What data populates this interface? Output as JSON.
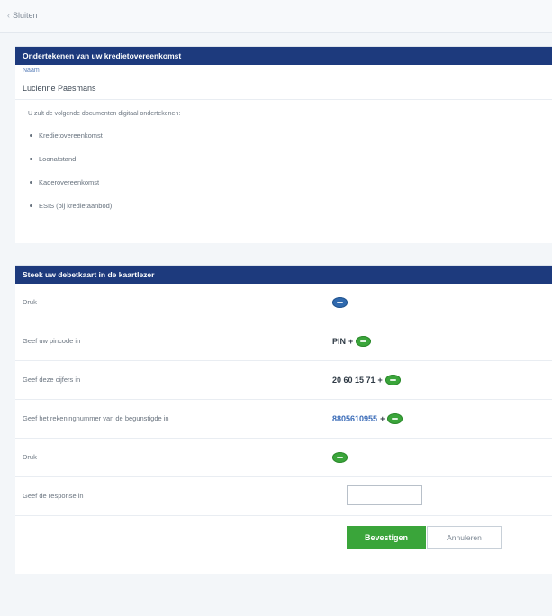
{
  "nav": {
    "back_label": "Sluiten"
  },
  "sign_panel": {
    "title": "Ondertekenen van uw kredietovereenkomst",
    "name_label": "Naam",
    "name_value": "Lucienne Paesmans",
    "intro": "U zult de volgende documenten digitaal ondertekenen:",
    "documents": [
      "Kredietovereenkomst",
      "Loonafstand",
      "Kaderovereenkomst",
      "ESIS (bij kredietaanbod)"
    ]
  },
  "card_panel": {
    "title": "Steek uw debetkaart in de kaartlezer",
    "steps": [
      {
        "label": "Druk",
        "value": "",
        "key": "blue-icon"
      },
      {
        "label": "Geef uw pincode in",
        "value": "PIN",
        "key": "ok-icon"
      },
      {
        "label": "Geef deze cijfers in",
        "value": "20 60 15 71",
        "key": "ok-icon"
      },
      {
        "label": "Geef het rekeningnummer van de begunstigde in",
        "value": "8805610955",
        "key": "ok-icon"
      },
      {
        "label": "Druk",
        "value": "",
        "key": "ok-icon"
      }
    ],
    "response_label": "Geef de response in",
    "response_value": "",
    "confirm_label": "Bevestigen",
    "cancel_label": "Annuleren"
  },
  "colors": {
    "header_bg": "#1d3a7d",
    "ok_green": "#3aa53a",
    "link_blue": "#3b6cb8"
  }
}
